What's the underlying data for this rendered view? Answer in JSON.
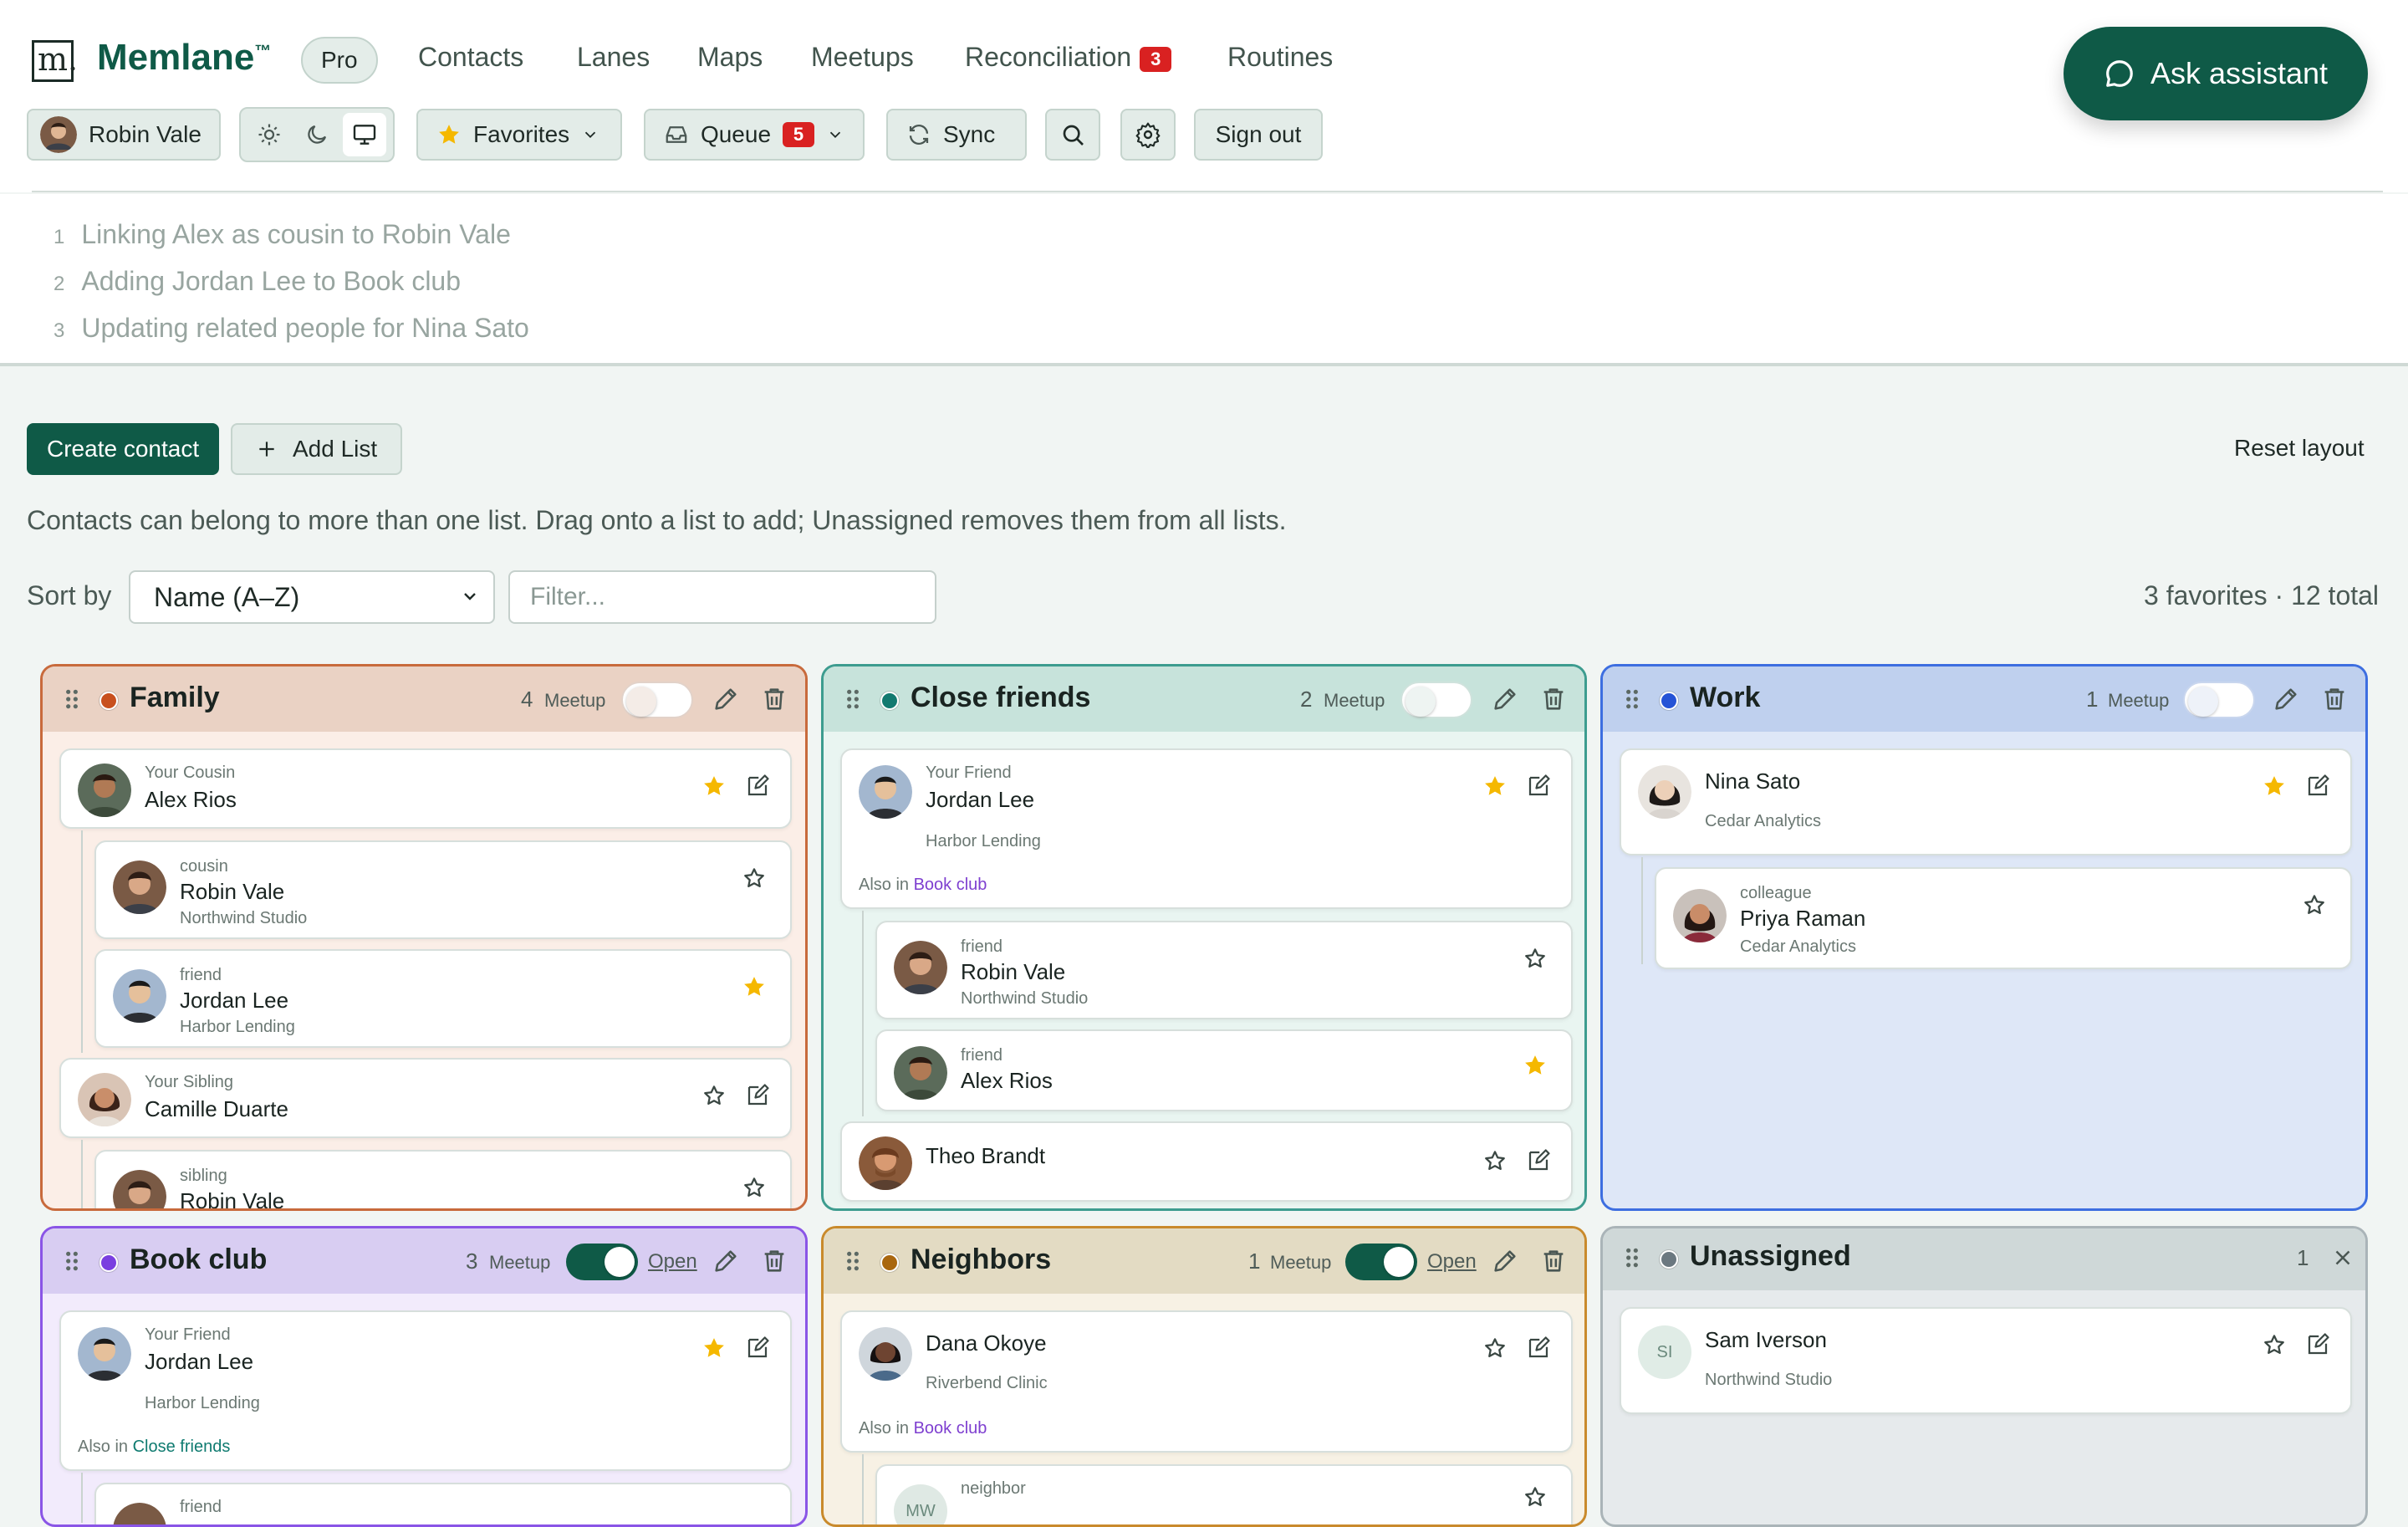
{
  "app": {
    "brand": "Memlane",
    "tm": "™",
    "plan": "Pro",
    "logo_letter": "m."
  },
  "nav": [
    {
      "label": "Contacts"
    },
    {
      "label": "Lanes"
    },
    {
      "label": "Maps"
    },
    {
      "label": "Meetups"
    },
    {
      "label": "Reconciliation",
      "badge": "3"
    },
    {
      "label": "Routines"
    }
  ],
  "assistant": {
    "label": "Ask assistant"
  },
  "toolbar": {
    "user": "Robin Vale",
    "favorites": "Favorites",
    "queue": "Queue",
    "queue_badge": "5",
    "sync": "Sync",
    "signout": "Sign out"
  },
  "log": [
    {
      "num": "1",
      "text": "Linking Alex as cousin to Robin Vale"
    },
    {
      "num": "2",
      "text": "Adding Jordan Lee to Book club"
    },
    {
      "num": "3",
      "text": "Updating related people for Nina Sato"
    }
  ],
  "actions": {
    "create": "Create contact",
    "add_list": "Add List",
    "reset": "Reset layout"
  },
  "hint": "Contacts can belong to more than one list. Drag onto a list to add; Unassigned removes them from all lists.",
  "sort": {
    "label": "Sort by",
    "value": "Name (A–Z)",
    "filter_placeholder": "Filter...",
    "totals": "3 favorites · 12 total"
  },
  "lists": {
    "family": {
      "title": "Family",
      "count": "4",
      "meetup": "Meetup",
      "color": "#c8501e",
      "cards": [
        {
          "rel": "Your Cousin",
          "name": "Alex Rios",
          "fav": true
        },
        {
          "rel": "cousin",
          "name": "Robin Vale",
          "org": "Northwind Studio",
          "fav": false
        },
        {
          "rel": "friend",
          "name": "Jordan Lee",
          "org": "Harbor Lending",
          "fav": true
        },
        {
          "rel": "Your Sibling",
          "name": "Camille Duarte",
          "fav": false
        },
        {
          "rel": "sibling",
          "name": "Robin Vale",
          "fav": false
        }
      ]
    },
    "close": {
      "title": "Close friends",
      "count": "2",
      "meetup": "Meetup",
      "color": "#137a70",
      "cards": [
        {
          "rel": "Your Friend",
          "name": "Jordan Lee",
          "org": "Harbor Lending",
          "also_prefix": "Also in",
          "also": "Book club",
          "fav": true
        },
        {
          "rel": "friend",
          "name": "Robin Vale",
          "org": "Northwind Studio",
          "fav": false
        },
        {
          "rel": "friend",
          "name": "Alex Rios",
          "fav": true
        },
        {
          "name": "Theo Brandt",
          "fav": false
        }
      ]
    },
    "work": {
      "title": "Work",
      "count": "1",
      "meetup": "Meetup",
      "color": "#2553d6",
      "cards": [
        {
          "name": "Nina Sato",
          "org": "Cedar Analytics",
          "fav": true
        },
        {
          "rel": "colleague",
          "name": "Priya Raman",
          "org": "Cedar Analytics",
          "fav": false
        }
      ]
    },
    "book": {
      "title": "Book club",
      "count": "3",
      "meetup": "Meetup",
      "open": "Open",
      "color": "#7a3fe0",
      "cards": [
        {
          "rel": "Your Friend",
          "name": "Jordan Lee",
          "org": "Harbor Lending",
          "also_prefix": "Also in",
          "also": "Close friends",
          "fav": true
        },
        {
          "rel": "friend"
        }
      ]
    },
    "neighbors": {
      "title": "Neighbors",
      "count": "1",
      "meetup": "Meetup",
      "open": "Open",
      "color": "#a9670f",
      "cards": [
        {
          "name": "Dana Okoye",
          "org": "Riverbend Clinic",
          "also_prefix": "Also in",
          "also": "Book club",
          "fav": false
        },
        {
          "rel": "neighbor",
          "initials": "MW"
        }
      ]
    },
    "unassigned": {
      "title": "Unassigned",
      "count": "1",
      "color": "#6b7880",
      "cards": [
        {
          "name": "Sam Iverson",
          "org": "Northwind Studio",
          "initials": "SI",
          "fav": false
        }
      ]
    }
  }
}
